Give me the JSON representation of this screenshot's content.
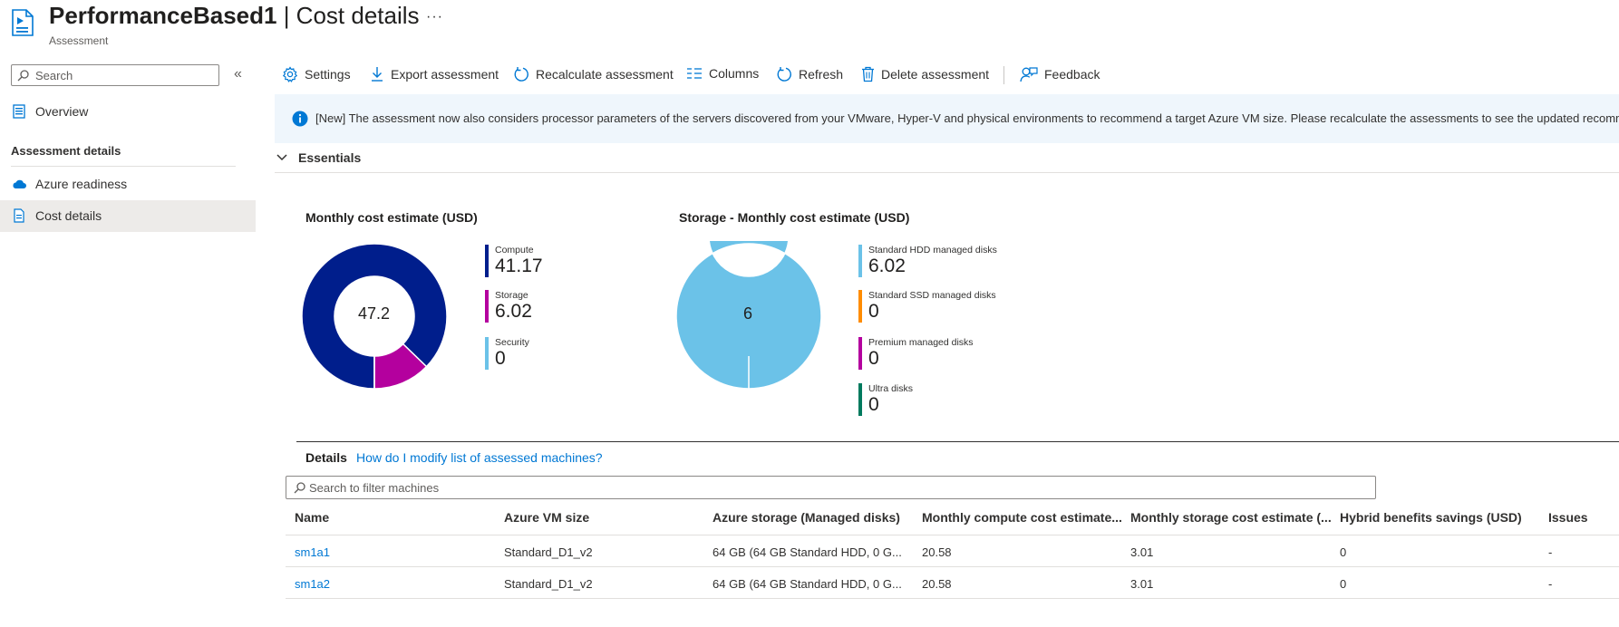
{
  "header": {
    "title_bold": "PerformanceBased1",
    "title_sep": " | ",
    "title_rest": "Cost details",
    "subtitle": "Assessment",
    "more": "···"
  },
  "sidebar": {
    "search_placeholder": "Search",
    "collapse": "«",
    "overview": "Overview",
    "group_title": "Assessment details",
    "items": [
      {
        "label": "Azure readiness",
        "icon": "cloud-icon"
      },
      {
        "label": "Cost details",
        "icon": "document-icon"
      }
    ]
  },
  "toolbar": {
    "settings": "Settings",
    "export": "Export assessment",
    "recalculate": "Recalculate assessment",
    "columns": "Columns",
    "refresh": "Refresh",
    "delete": "Delete assessment",
    "feedback": "Feedback"
  },
  "banner": {
    "text": "[New] The assessment now also considers processor parameters of the servers discovered from your VMware, Hyper-V and physical environments to recommend a target Azure VM size. Please recalculate the assessments to see the updated recommendations."
  },
  "essentials": {
    "label": "Essentials"
  },
  "colors": {
    "compute": "#001e8c",
    "storage": "#b4009e",
    "security": "#6bc2e8",
    "hdd": "#6bc2e8",
    "ssd": "#ff8c00",
    "premium": "#b4009e",
    "ultra": "#007a5e",
    "link": "#0078d4"
  },
  "chart_data": [
    {
      "type": "pie",
      "title": "Monthly cost estimate (USD)",
      "center_label": "47.2",
      "categories": [
        "Compute",
        "Storage",
        "Security"
      ],
      "values": [
        41.17,
        6.02,
        0
      ],
      "value_labels": [
        "41.17",
        "6.02",
        "0"
      ]
    },
    {
      "type": "pie",
      "title": "Storage - Monthly cost estimate (USD)",
      "center_label": "6",
      "categories": [
        "Standard HDD managed disks",
        "Standard SSD managed disks",
        "Premium managed disks",
        "Ultra disks"
      ],
      "values": [
        6.02,
        0,
        0,
        0
      ],
      "value_labels": [
        "6.02",
        "0",
        "0",
        "0"
      ]
    }
  ],
  "details": {
    "title": "Details",
    "link": "How do I modify list of assessed machines?",
    "filter_placeholder": "Search to filter machines",
    "columns": [
      "Name",
      "Azure VM size",
      "Azure storage (Managed disks)",
      "Monthly compute cost estimate...",
      "Monthly storage cost estimate (...",
      "Hybrid benefits savings (USD)",
      "Issues"
    ],
    "rows": [
      [
        "sm1a1",
        "Standard_D1_v2",
        "64 GB (64 GB Standard HDD, 0 G...",
        "20.58",
        "3.01",
        "0",
        "-"
      ],
      [
        "sm1a2",
        "Standard_D1_v2",
        "64 GB (64 GB Standard HDD, 0 G...",
        "20.58",
        "3.01",
        "0",
        "-"
      ]
    ]
  }
}
